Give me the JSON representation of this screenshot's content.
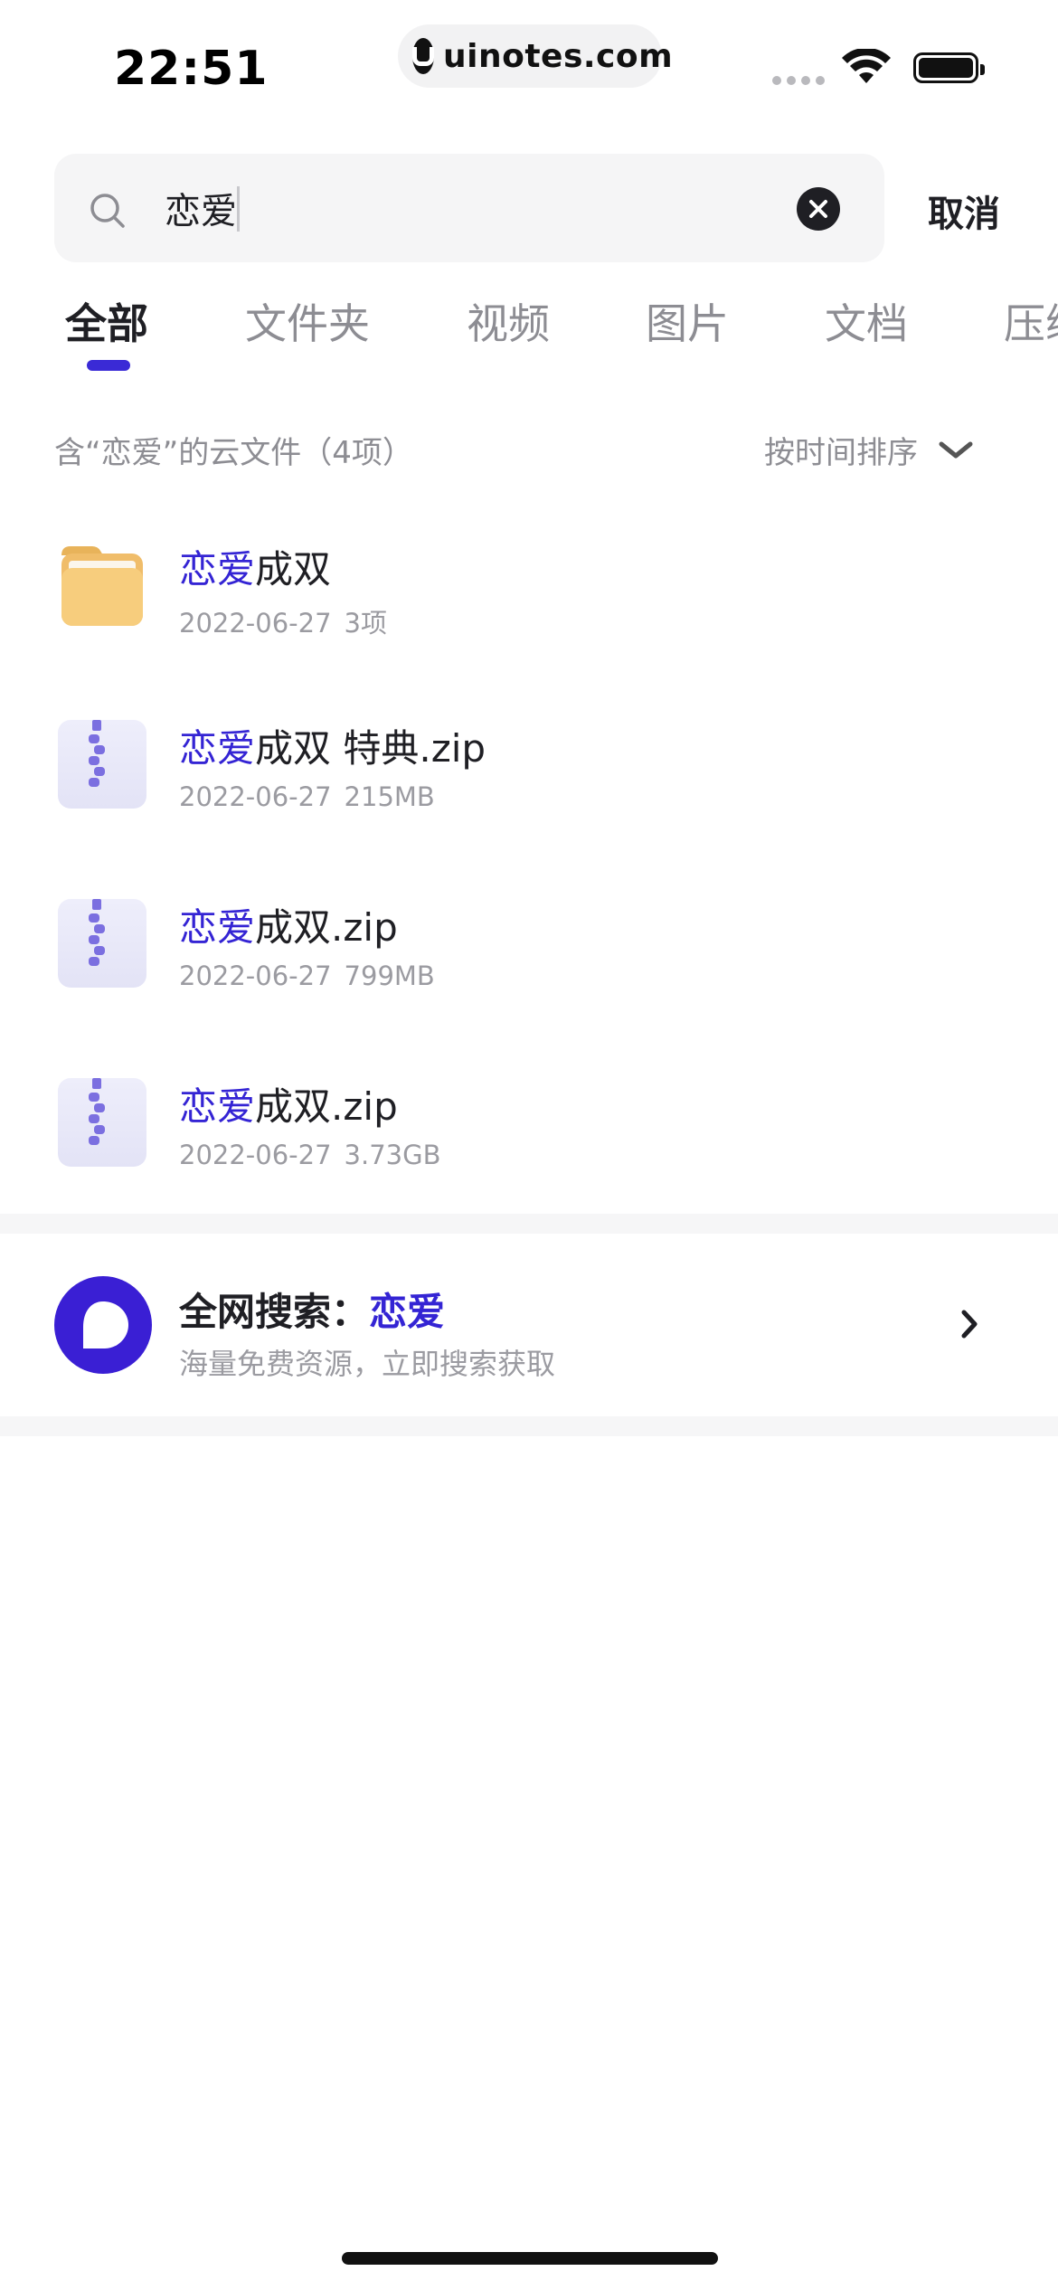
{
  "status_bar": {
    "time": "22:51",
    "site": "uinotes.com"
  },
  "search": {
    "query": "恋爱",
    "cancel_label": "取消"
  },
  "tabs": [
    {
      "label": "全部",
      "active": true
    },
    {
      "label": "文件夹",
      "active": false
    },
    {
      "label": "视频",
      "active": false
    },
    {
      "label": "图片",
      "active": false
    },
    {
      "label": "文档",
      "active": false
    },
    {
      "label": "压缩",
      "active": false
    }
  ],
  "results": {
    "summary": "含“恋爱”的云文件（4项）",
    "sort_label": "按时间排序",
    "items": [
      {
        "icon": "folder-icon",
        "highlight": "恋爱",
        "rest": "成双",
        "date": "2022-06-27",
        "info": "3项"
      },
      {
        "icon": "zip-file-icon",
        "highlight": "恋爱",
        "rest": "成双 特典.zip",
        "date": "2022-06-27",
        "info": "215MB"
      },
      {
        "icon": "zip-file-icon",
        "highlight": "恋爱",
        "rest": "成双.zip",
        "date": "2022-06-27",
        "info": "799MB"
      },
      {
        "icon": "zip-file-icon",
        "highlight": "恋爱",
        "rest": "成双.zip",
        "date": "2022-06-27",
        "info": "3.73GB"
      }
    ]
  },
  "web_search": {
    "prefix": "全网搜索：",
    "keyword": "恋爱",
    "subtitle": "海量免费资源，立即搜索获取"
  },
  "colors": {
    "accent": "#3a2ad6",
    "highlight": "#3424d4",
    "folder": "#f5c876",
    "zip": "#7b6fe0"
  }
}
